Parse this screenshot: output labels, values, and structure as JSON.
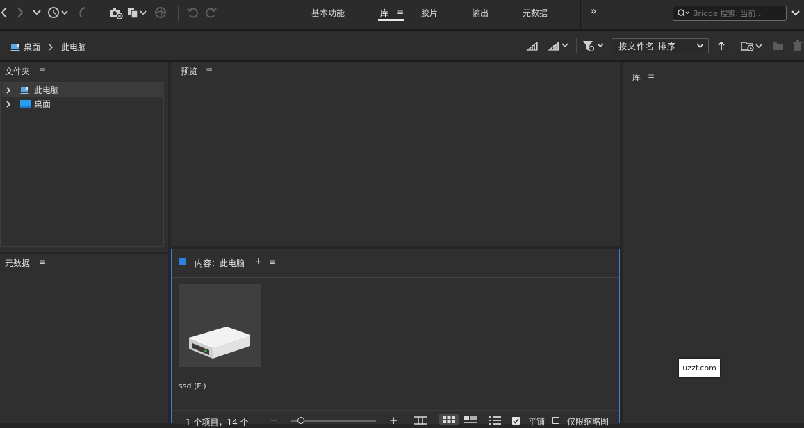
{
  "toolbar": {
    "workspace_tabs": [
      "基本功能",
      "库",
      "胶片",
      "输出",
      "元数据"
    ],
    "active_tab": "库",
    "search_placeholder": "Bridge 搜索: 当前...",
    "more_label": "»"
  },
  "pathbar": {
    "breadcrumb": [
      "桌面",
      "此电脑"
    ],
    "sort_label": "按文件名 排序"
  },
  "panels": {
    "folders": {
      "title": "文件夹",
      "items": [
        {
          "label": "此电脑",
          "icon": "computer-icon"
        },
        {
          "label": "桌面",
          "icon": "folder-icon"
        }
      ]
    },
    "preview": {
      "title": "预览"
    },
    "metadata": {
      "title": "元数据"
    },
    "library": {
      "title": "库"
    },
    "content": {
      "title": "内容：此电脑",
      "add_label": "+",
      "items": [
        {
          "label": "ssd (F:)",
          "icon": "hard-drive-icon"
        }
      ]
    }
  },
  "statusbar": {
    "count_text": "1 个项目，14 个",
    "tile_label": "平铺",
    "thumbs_only_label": "仅限缩略图"
  },
  "watermark": {
    "text": "uzzf.com"
  },
  "colors": {
    "accent": "#2d7fe0",
    "folder": "#2a9cf0"
  }
}
